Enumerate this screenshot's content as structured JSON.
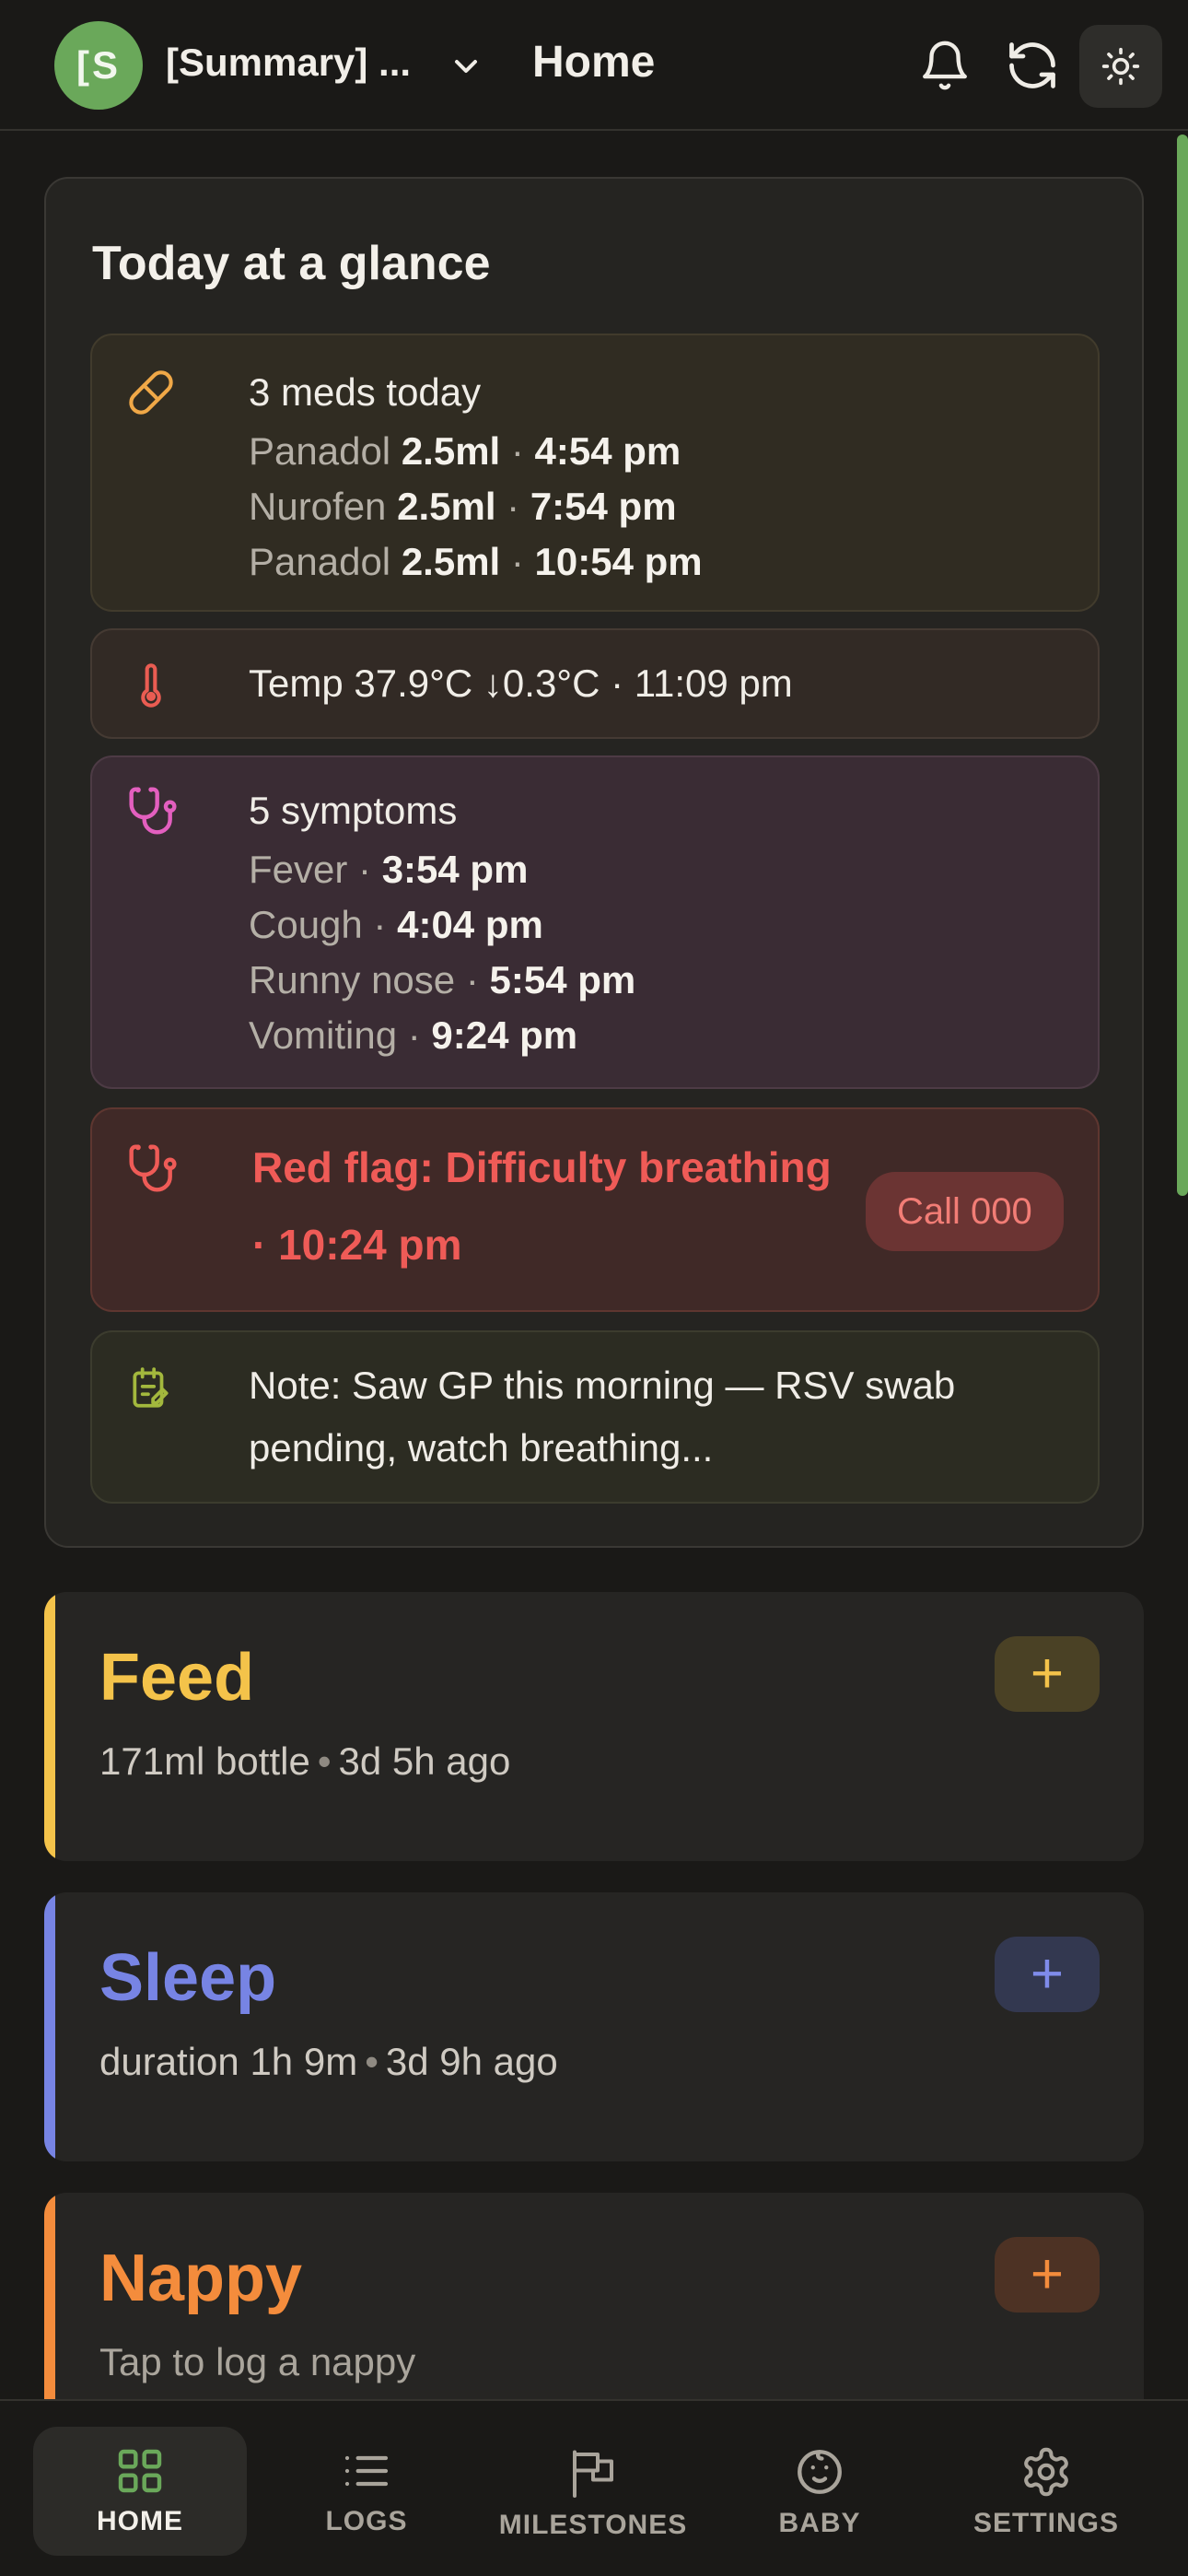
{
  "header": {
    "avatar_initials": "[S",
    "profile_name": "[Summary] ...",
    "title": "Home"
  },
  "glance": {
    "title": "Today at a glance",
    "meds": {
      "heading": "3 meds today",
      "items": [
        {
          "name": "Panadol",
          "dose": "2.5ml",
          "time": "4:54 pm"
        },
        {
          "name": "Nurofen",
          "dose": "2.5ml",
          "time": "7:54 pm"
        },
        {
          "name": "Panadol",
          "dose": "2.5ml",
          "time": "10:54 pm"
        }
      ]
    },
    "temp": {
      "text": "Temp 37.9°C ↓0.3°C · 11:09 pm"
    },
    "symptoms": {
      "heading": "5 symptoms",
      "items": [
        {
          "name": "Fever",
          "time": "3:54 pm"
        },
        {
          "name": "Cough",
          "time": "4:04 pm"
        },
        {
          "name": "Runny nose",
          "time": "5:54 pm"
        },
        {
          "name": "Vomiting",
          "time": "9:24 pm"
        }
      ]
    },
    "red_flag": {
      "line1": "Red flag: Difficulty breathing",
      "line2": "· 10:24 pm",
      "call_label": "Call 000"
    },
    "note": {
      "line1": "Note: Saw GP this morning — RSV swab",
      "line2": "pending, watch breathing..."
    }
  },
  "activities": [
    {
      "name": "Feed",
      "sub_a": "171ml bottle",
      "sub_b": "3d 5h ago",
      "add": "+"
    },
    {
      "name": "Sleep",
      "sub_a": "duration 1h 9m",
      "sub_b": "3d 9h ago",
      "add": "+"
    },
    {
      "name": "Nappy",
      "sub_a": "Tap to log a nappy",
      "add": "+"
    }
  ],
  "nav": {
    "items": [
      {
        "label": "HOME"
      },
      {
        "label": "LOGS"
      },
      {
        "label": "MILESTONES"
      },
      {
        "label": "BABY"
      },
      {
        "label": "SETTINGS"
      }
    ]
  },
  "colors": {
    "feed": "#f4c34a",
    "sleep": "#7784e4",
    "nappy": "#f48c3c",
    "accent_green": "#6aa85a",
    "red_flag": "#ef5b57"
  },
  "icons": {
    "header": [
      "chevron-down-icon",
      "bell-icon",
      "refresh-icon",
      "sun-icon"
    ],
    "glance": [
      "pill-icon",
      "thermometer-icon",
      "stethoscope-icon",
      "note-icon"
    ],
    "nav": [
      "grid-icon",
      "list-icon",
      "flag-icon",
      "baby-face-icon",
      "gear-icon"
    ]
  }
}
